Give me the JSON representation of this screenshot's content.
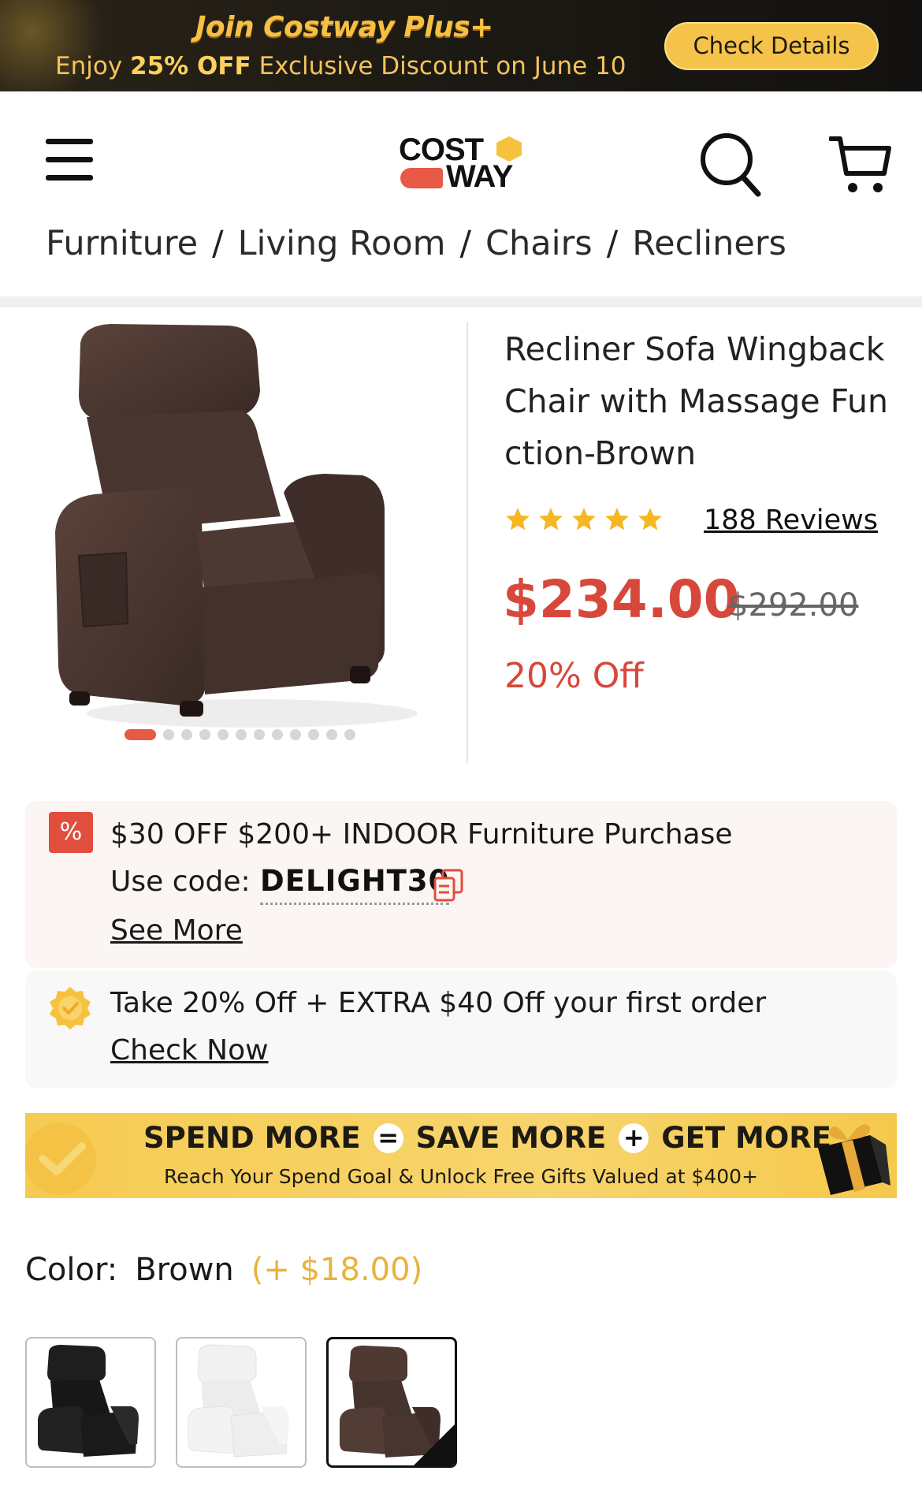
{
  "promo": {
    "title": "Join Costway Plus+",
    "subtitle_prefix": "Enjoy ",
    "subtitle_bold": "25% OFF",
    "subtitle_suffix": " Exclusive Discount on June 10",
    "button_label": "Check Details"
  },
  "header": {
    "logo_top": "COST",
    "logo_bottom": "WAY",
    "icons": [
      "menu-icon",
      "search-icon",
      "cart-icon"
    ]
  },
  "breadcrumb": [
    "Furniture",
    "Living Room",
    "Chairs",
    "Recliners"
  ],
  "breadcrumb_separator": "/",
  "product": {
    "title": "Recliner Sofa Wingback Chair with Massage Function-Brown",
    "rating": 5,
    "reviews": "188 Reviews",
    "price": "$234.00",
    "old_price": "$292.00",
    "discount": "20% Off",
    "image_count": 13,
    "image_index": 1
  },
  "coupon": {
    "badge": "%",
    "line1": "$30 OFF $200+ INDOOR Furniture Purchase",
    "code_label": "Use code:",
    "code": "DELIGHT30",
    "see_more": "See More"
  },
  "first_order": {
    "text": "Take 20% Off + EXTRA $40 Off your first order",
    "link": "Check Now"
  },
  "spend_banner": {
    "spend": "SPEND MORE",
    "equals": "=",
    "save": "SAVE MORE",
    "plus": "+",
    "get": "GET MORE",
    "sub": "Reach Your Spend Goal & Unlock Free Gifts Valued at $400+"
  },
  "color": {
    "label": "Color:",
    "value": "Brown",
    "extra": "(+ $18.00)",
    "options": [
      "black",
      "white",
      "brown"
    ],
    "selected": "brown"
  },
  "colors": {
    "accent": "#d7483a",
    "star": "#f5b722",
    "promo_gold": "#f5c34a"
  }
}
